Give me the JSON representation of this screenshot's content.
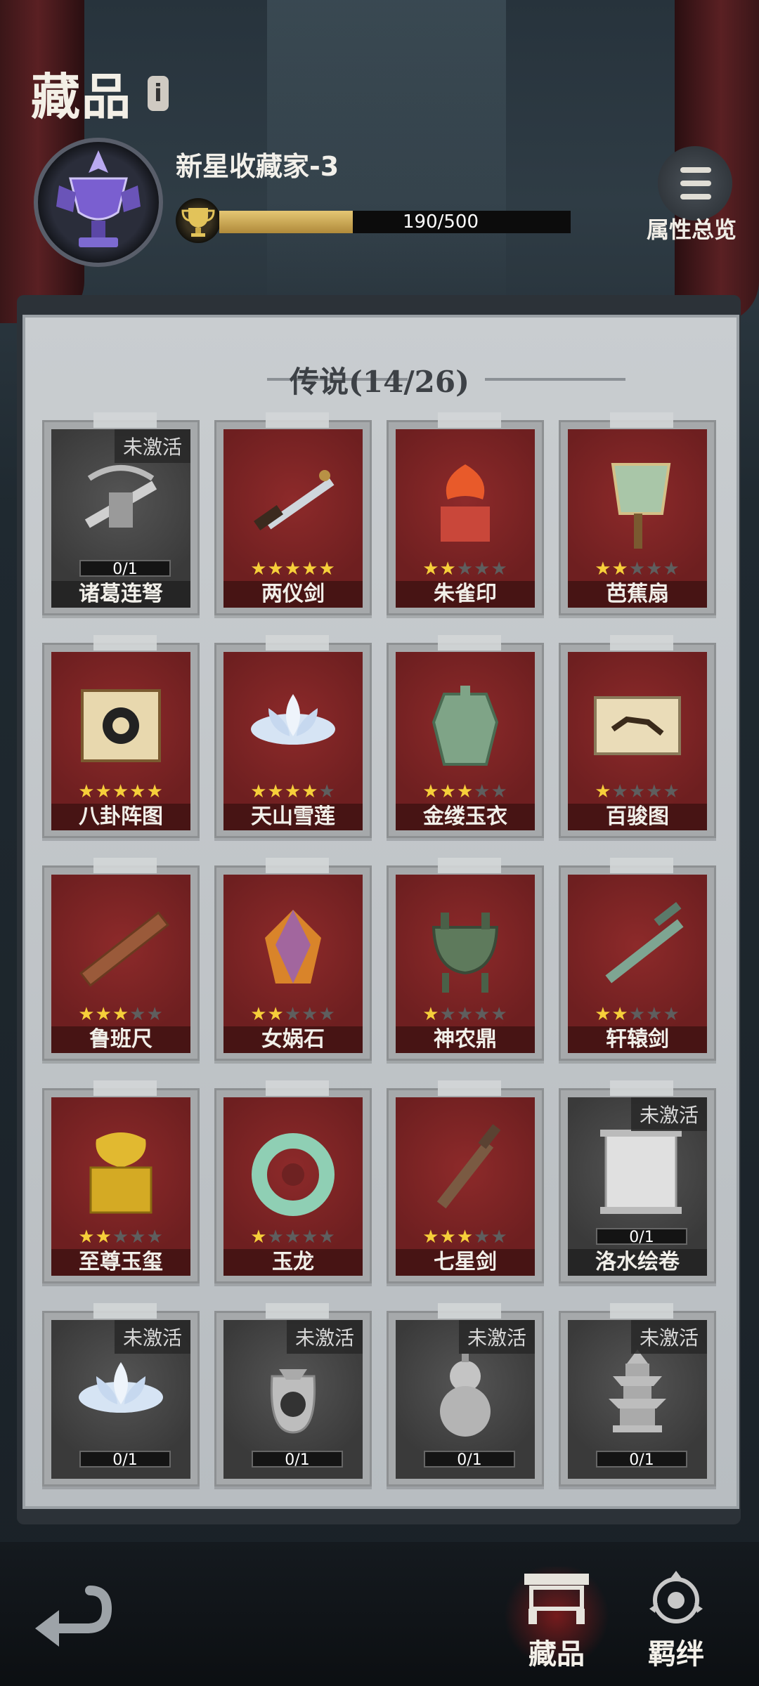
{
  "header": {
    "title": "藏品",
    "info_icon": "i",
    "rank_name": "新星收藏家-3",
    "progress": {
      "current": 190,
      "max": 500,
      "text": "190/500",
      "fraction": 0.38
    },
    "attr_label": "属性总览"
  },
  "section": {
    "title": "传说(14/26)"
  },
  "colors": {
    "card_active": "#7a2324",
    "card_inactive": "#444444",
    "star_on": "#f6cf3a",
    "star_off": "#5e5e5e",
    "progress": "#d9b75e"
  },
  "items": [
    {
      "name": "诸葛连弩",
      "active": false,
      "badge": "未激活",
      "count": "0/1",
      "icon": "crossbow-icon"
    },
    {
      "name": "两仪剑",
      "active": true,
      "stars": 5,
      "icon": "sword-icon"
    },
    {
      "name": "朱雀印",
      "active": true,
      "stars": 2,
      "icon": "phoenix-seal-icon"
    },
    {
      "name": "芭蕉扇",
      "active": true,
      "stars": 2,
      "icon": "fan-icon"
    },
    {
      "name": "八卦阵图",
      "active": true,
      "stars": 5,
      "icon": "bagua-scroll-icon"
    },
    {
      "name": "天山雪莲",
      "active": true,
      "stars": 4,
      "icon": "lotus-icon"
    },
    {
      "name": "金缕玉衣",
      "active": true,
      "stars": 3,
      "icon": "jade-armor-icon"
    },
    {
      "name": "百骏图",
      "active": true,
      "stars": 1,
      "icon": "horse-painting-icon"
    },
    {
      "name": "鲁班尺",
      "active": true,
      "stars": 3,
      "icon": "ruler-icon"
    },
    {
      "name": "女娲石",
      "active": true,
      "stars": 2,
      "icon": "crystal-stone-icon"
    },
    {
      "name": "神农鼎",
      "active": true,
      "stars": 1,
      "icon": "cauldron-icon"
    },
    {
      "name": "轩辕剑",
      "active": true,
      "stars": 2,
      "icon": "jade-sword-icon"
    },
    {
      "name": "至尊玉玺",
      "active": true,
      "stars": 2,
      "icon": "imperial-seal-icon"
    },
    {
      "name": "玉龙",
      "active": true,
      "stars": 1,
      "icon": "jade-dragon-icon"
    },
    {
      "name": "七星剑",
      "active": true,
      "stars": 3,
      "icon": "bronze-sword-icon"
    },
    {
      "name": "洛水绘卷",
      "active": false,
      "badge": "未激活",
      "count": "0/1",
      "icon": "scroll-icon"
    },
    {
      "name": "",
      "active": false,
      "badge": "未激活",
      "count": "0/1",
      "icon": "lotus-icon"
    },
    {
      "name": "",
      "active": false,
      "badge": "未激活",
      "count": "0/1",
      "icon": "pouch-icon"
    },
    {
      "name": "",
      "active": false,
      "badge": "未激活",
      "count": "0/1",
      "icon": "gourd-icon"
    },
    {
      "name": "",
      "active": false,
      "badge": "未激活",
      "count": "0/1",
      "icon": "pagoda-icon"
    }
  ],
  "nav": {
    "back_icon": "back-arrow-icon",
    "tabs": [
      {
        "label": "藏品",
        "active": true,
        "icon": "collection-icon"
      },
      {
        "label": "羁绊",
        "active": false,
        "icon": "bond-icon"
      }
    ]
  }
}
